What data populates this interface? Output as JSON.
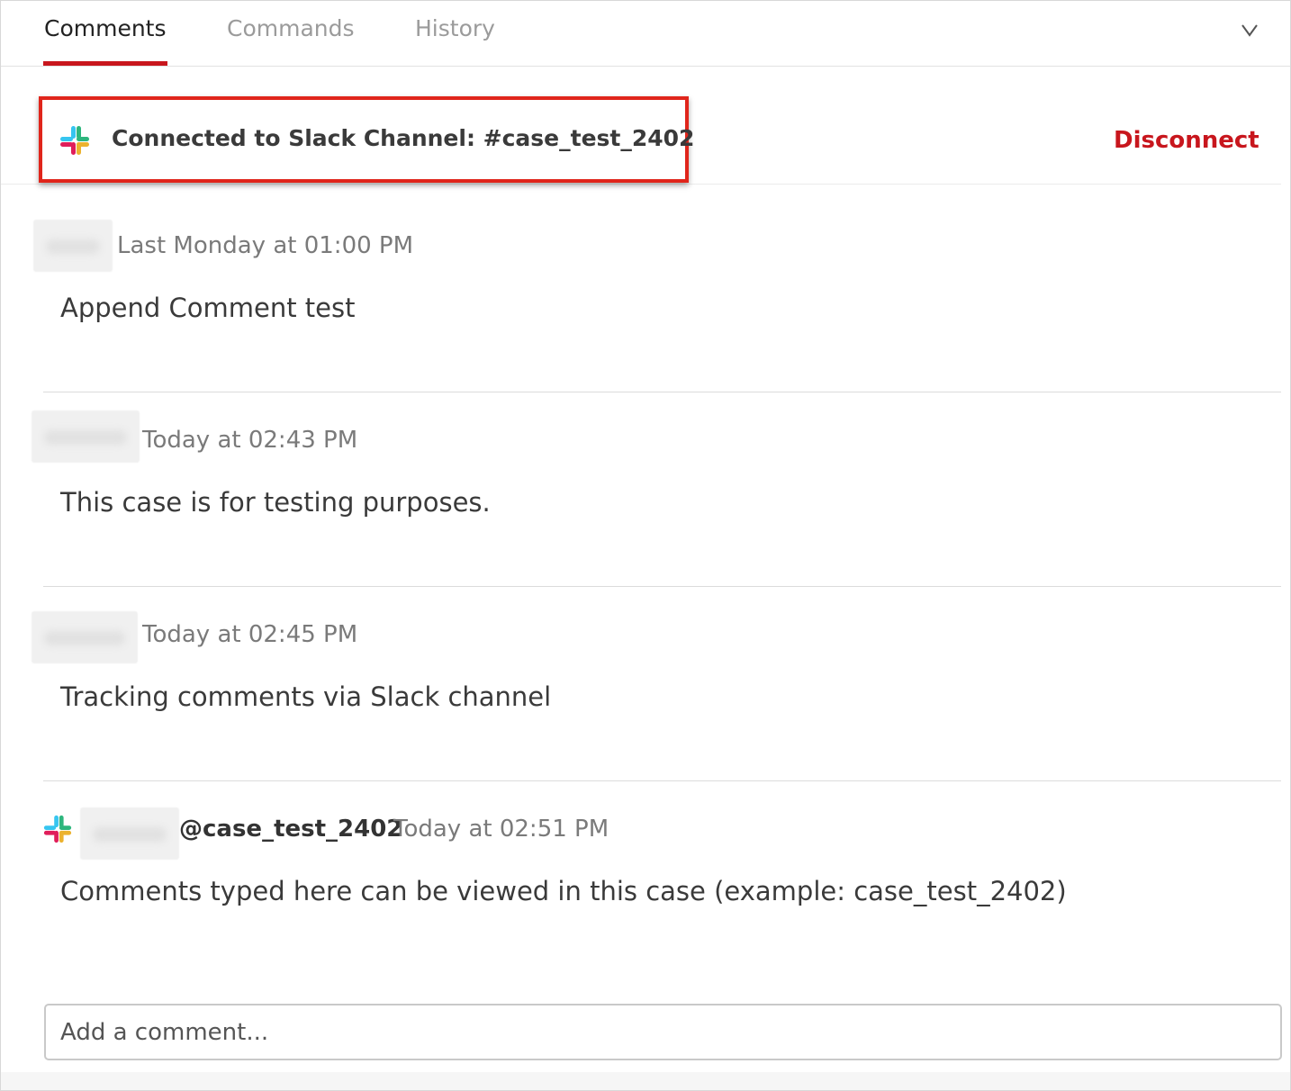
{
  "tabs": [
    {
      "label": "Comments",
      "active": true
    },
    {
      "label": "Commands",
      "active": false
    },
    {
      "label": "History",
      "active": false
    }
  ],
  "slack": {
    "connected_text": "Connected to Slack Channel: #case_test_2402",
    "disconnect_label": "Disconnect",
    "icon": "slack-icon"
  },
  "comments": [
    {
      "timestamp": "Last Monday at 01:00 PM",
      "body": "Append Comment test"
    },
    {
      "timestamp": "Today at 02:43 PM",
      "body": "This case is for testing purposes."
    },
    {
      "timestamp": "Today at 02:45 PM",
      "body": "Tracking comments via Slack channel"
    },
    {
      "handle": "@case_test_2402",
      "timestamp": "Today at 02:51 PM",
      "body": "Comments typed here can be viewed in this case (example: case_test_2402)",
      "source_icon": "slack-icon"
    }
  ],
  "comment_input": {
    "placeholder": "Add a comment..."
  },
  "colors": {
    "accent": "#c8161d",
    "highlight": "#e0251b"
  }
}
